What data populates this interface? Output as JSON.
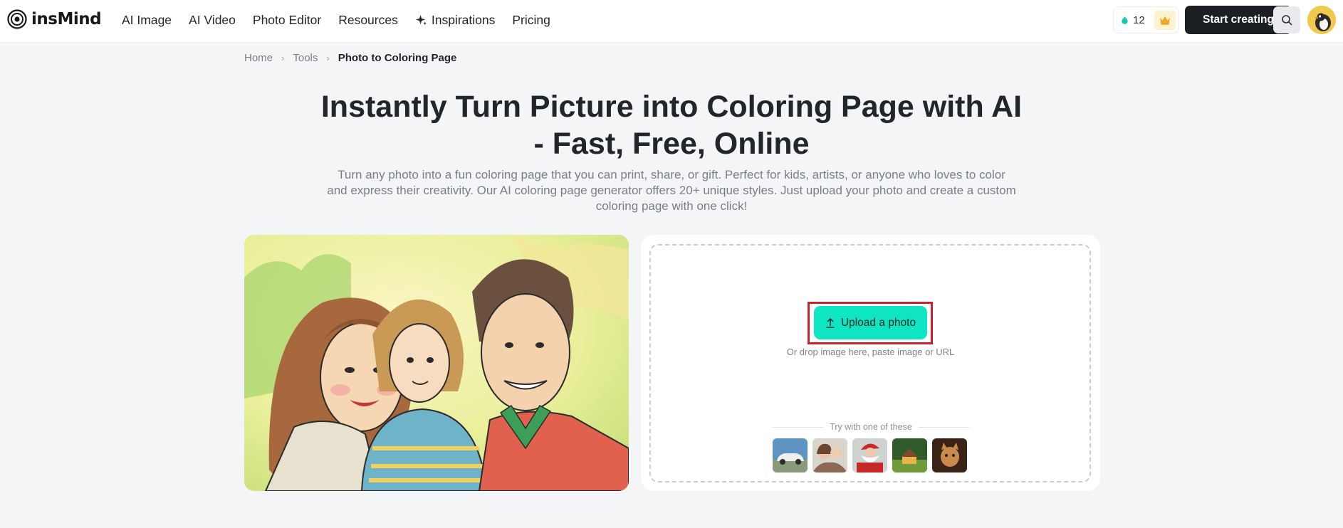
{
  "brand": {
    "name": "insMind"
  },
  "nav": {
    "items": [
      {
        "label": "AI Image",
        "name": "nav-ai-image"
      },
      {
        "label": "AI Video",
        "name": "nav-ai-video"
      },
      {
        "label": "Photo Editor",
        "name": "nav-photo-editor"
      },
      {
        "label": "Resources",
        "name": "nav-resources"
      },
      {
        "label": "Inspirations",
        "name": "nav-inspirations",
        "icon": "sparkle-icon"
      },
      {
        "label": "Pricing",
        "name": "nav-pricing"
      }
    ]
  },
  "header_right": {
    "credits_count": "12",
    "credits_icon": "droplet-icon",
    "premium_icon": "crown-icon",
    "start_label": "Start creating",
    "search_icon": "search-icon"
  },
  "breadcrumb": {
    "items": [
      "Home",
      "Tools"
    ],
    "current": "Photo to Coloring Page"
  },
  "hero": {
    "title": "Instantly Turn Picture into Coloring Page with AI - Fast, Free, Online",
    "subtitle": "Turn any photo into a fun coloring page that you can print, share, or gift. Perfect for kids, artists, or anyone who loves to color and express their creativity. Our AI coloring page generator offers 20+ unique styles. Just upload your photo and create a custom coloring page with one click!"
  },
  "upload": {
    "button_label": "Upload a photo",
    "button_icon": "upload-arrow-icon",
    "hint": "Or drop image here, paste image or URL",
    "try_label": "Try with one of these",
    "samples": [
      "sample-car",
      "sample-couple",
      "sample-santa",
      "sample-house",
      "sample-cat"
    ]
  },
  "colors": {
    "accent": "#0fe5c2",
    "start_button": "#1b1e23",
    "highlight": "#c8232c",
    "page_background": "#f4f5f7"
  }
}
